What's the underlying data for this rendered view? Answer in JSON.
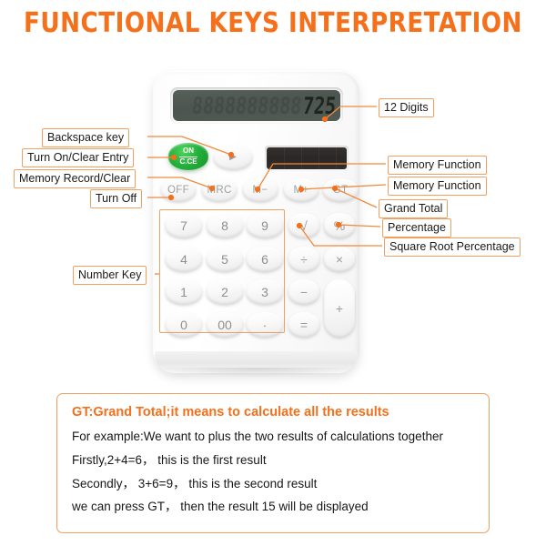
{
  "page": {
    "title": "FUNCTIONAL KEYS INTERPRETATION",
    "background_color": "#FFFFFF",
    "accent_color": "#F4701B",
    "box_border_color": "#F0A060"
  },
  "calculator": {
    "display": {
      "ghost_digits": "8888888888",
      "live_digits": "725",
      "digit_capacity": "12"
    },
    "solar_panel_label": "solar-panel",
    "function_row": [
      {
        "id": "off",
        "label": "OFF"
      },
      {
        "id": "mrc",
        "label": "MRC"
      },
      {
        "id": "m-minus",
        "label": "M−"
      },
      {
        "id": "m-plus",
        "label": "M+"
      },
      {
        "id": "gt",
        "label": "GT"
      }
    ],
    "power_key": {
      "line1": "ON",
      "line2": "C.CE"
    },
    "backspace_key": {
      "label": "▶"
    },
    "number_keys": [
      {
        "id": "7",
        "label": "7"
      },
      {
        "id": "8",
        "label": "8"
      },
      {
        "id": "9",
        "label": "9"
      },
      {
        "id": "4",
        "label": "4"
      },
      {
        "id": "5",
        "label": "5"
      },
      {
        "id": "6",
        "label": "6"
      },
      {
        "id": "1",
        "label": "1"
      },
      {
        "id": "2",
        "label": "2"
      },
      {
        "id": "3",
        "label": "3"
      },
      {
        "id": "0",
        "label": "0"
      },
      {
        "id": "00",
        "label": "00"
      },
      {
        "id": "dot",
        "label": "·"
      }
    ],
    "operator_keys": [
      {
        "id": "sqrt",
        "label": "√"
      },
      {
        "id": "percent",
        "label": "%"
      },
      {
        "id": "divide",
        "label": "÷"
      },
      {
        "id": "multiply",
        "label": "×"
      },
      {
        "id": "minus",
        "label": "−"
      },
      {
        "id": "equals",
        "label": "="
      },
      {
        "id": "plus",
        "label": "+"
      }
    ]
  },
  "annotations": {
    "left": [
      {
        "id": "backspace-key",
        "text": "Backspace key"
      },
      {
        "id": "turn-on-clear-entry",
        "text": "Turn On/Clear Entry"
      },
      {
        "id": "memory-record-clear",
        "text": "Memory Record/Clear"
      },
      {
        "id": "turn-off",
        "text": "Turn Off"
      },
      {
        "id": "number-key",
        "text": "Number Key"
      }
    ],
    "right": [
      {
        "id": "12-digits",
        "text": "12 Digits"
      },
      {
        "id": "memory-function-1",
        "text": "Memory Function"
      },
      {
        "id": "memory-function-2",
        "text": "Memory Function"
      },
      {
        "id": "grand-total",
        "text": "Grand Total"
      },
      {
        "id": "percentage",
        "text": "Percentage"
      },
      {
        "id": "square-root-percentage",
        "text": "Square Root Percentage"
      }
    ]
  },
  "info_box": {
    "heading": "GT:Grand Total;it means to calculate all the results",
    "lines": [
      "For example:We want to plus the two  results of calculations together",
      "Firstly,2+4=6， this is the first result",
      "Secondly， 3+6=9， this is the second result",
      "we can press GT， then the result 15 will be displayed"
    ]
  }
}
